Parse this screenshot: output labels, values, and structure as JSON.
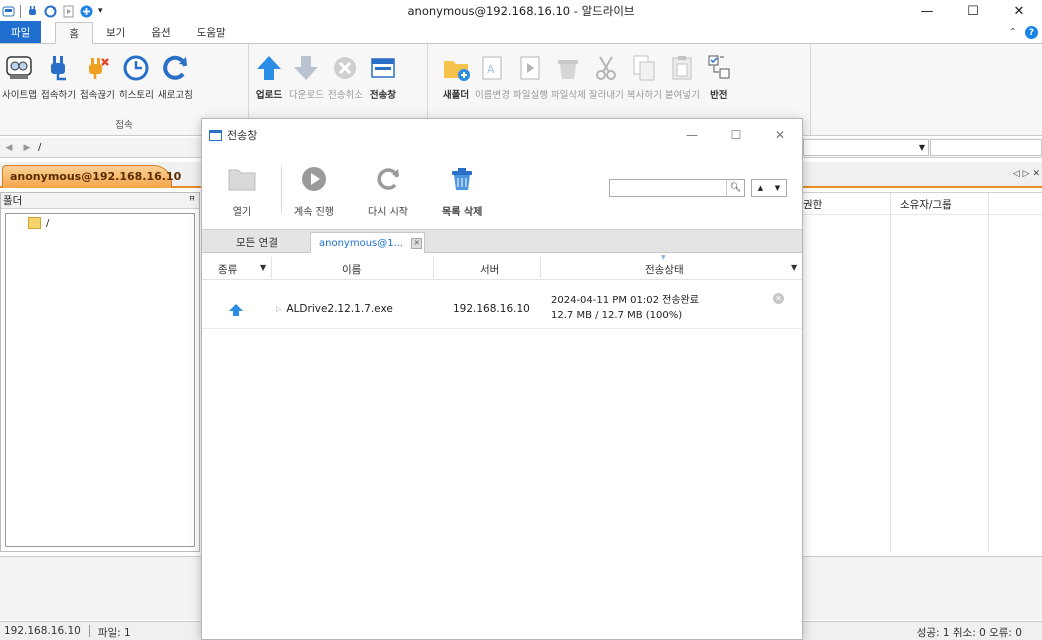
{
  "window": {
    "title": "anonymous@192.168.16.10 - 알드라이브",
    "minimize": "—",
    "maximize": "☐",
    "close": "✕"
  },
  "ribbon_tabs": [
    "파일",
    "홈",
    "보기",
    "옵션",
    "도움말"
  ],
  "ribbon": {
    "groups": [
      {
        "label": "접속",
        "buttons": [
          "사이트맵",
          "접속하기",
          "접속끊기",
          "히스토리",
          "새로고침"
        ]
      },
      {
        "label": "전송",
        "buttons": [
          "업로드",
          "다운로드",
          "전송취소",
          "전송창"
        ]
      },
      {
        "label": "편집",
        "buttons": [
          "새폴더",
          "이름변경",
          "파일실행",
          "파일삭제",
          "잘라내기",
          "복사하기",
          "붙여넣기",
          "반전"
        ]
      }
    ]
  },
  "address": {
    "path": "/"
  },
  "connection_tab": {
    "label": "anonymous@192.168.16.10"
  },
  "folder_panel": {
    "title": "폴더",
    "pin": "ꟸ",
    "items": [
      "/"
    ]
  },
  "file_panel": {
    "columns": [
      "권한",
      "소유자/그룹"
    ]
  },
  "statusbar": {
    "server": "192.168.16.10",
    "files": "파일: 1",
    "summary": "성공: 1 취소: 0 오류: 0"
  },
  "transfer_dialog": {
    "title": "전송창",
    "toolbar": [
      "열기",
      "계속 진행",
      "다시 시작",
      "목록 삭제"
    ],
    "tabs": {
      "all": "모든 연결",
      "current": "anonymous@1..."
    },
    "columns": {
      "type": "종류",
      "name": "이름",
      "server": "서버",
      "status": "전송상태"
    },
    "rows": [
      {
        "name": "ALDrive2.12.1.7.exe",
        "server": "192.168.16.10",
        "status_line1": "2024-04-11 PM 01:02 전송완료",
        "status_line2": "12.7 MB / 12.7 MB (100%)"
      }
    ]
  },
  "colors": {
    "accent": "#1f6fd1",
    "conn_tab": "#f3a54a",
    "upload_arrow": "#2a8ee6"
  }
}
